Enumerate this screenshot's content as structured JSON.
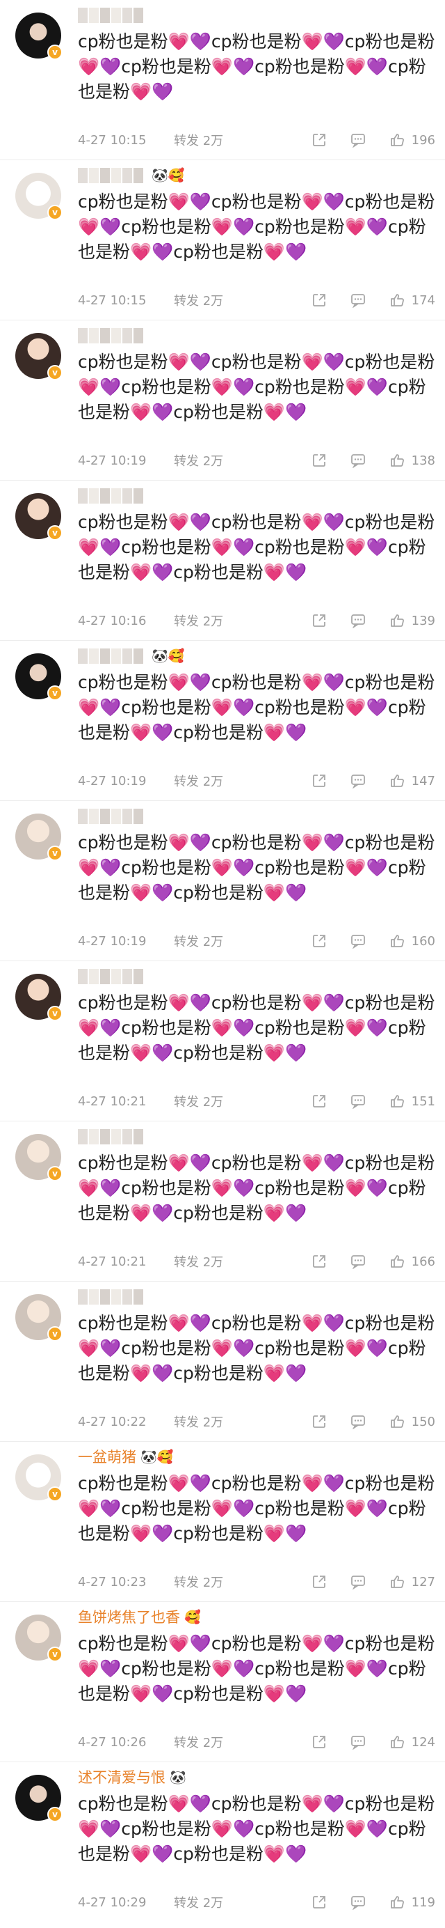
{
  "comments": [
    {
      "name": "",
      "emblems": "",
      "text": "cp粉也是粉💗💜cp粉也是粉💗💜cp粉也是粉💗💜cp粉也是粉💗💜cp粉也是粉💗💜cp粉也是粉💗💜",
      "time": "4-27 10:15",
      "repost": "转发 2万",
      "likes": "196",
      "avatar": "dark"
    },
    {
      "name": "",
      "emblems": "🐼🥰",
      "text": "cp粉也是粉💗💜cp粉也是粉💗💜cp粉也是粉💗💜cp粉也是粉💗💜cp粉也是粉💗💜cp粉也是粉💗💜cp粉也是粉💗💜",
      "time": "4-27 10:15",
      "repost": "转发 2万",
      "likes": "174",
      "avatar": "cartoon"
    },
    {
      "name": "",
      "emblems": "",
      "text": "cp粉也是粉💗💜cp粉也是粉💗💜cp粉也是粉💗💜cp粉也是粉💗💜cp粉也是粉💗💜cp粉也是粉💗💜cp粉也是粉💗💜",
      "time": "4-27 10:19",
      "repost": "转发 2万",
      "likes": "138",
      "avatar": "normal"
    },
    {
      "name": "",
      "emblems": "",
      "text": "cp粉也是粉💗💜cp粉也是粉💗💜cp粉也是粉💗💜cp粉也是粉💗💜cp粉也是粉💗💜cp粉也是粉💗💜cp粉也是粉💗💜",
      "time": "4-27 10:16",
      "repost": "转发 2万",
      "likes": "139",
      "avatar": "normal"
    },
    {
      "name": "",
      "emblems": "🐼🥰",
      "text": "cp粉也是粉💗💜cp粉也是粉💗💜cp粉也是粉💗💜cp粉也是粉💗💜cp粉也是粉💗💜cp粉也是粉💗💜cp粉也是粉💗💜",
      "time": "4-27 10:19",
      "repost": "转发 2万",
      "likes": "147",
      "avatar": "dark"
    },
    {
      "name": "",
      "emblems": "",
      "text": "cp粉也是粉💗💜cp粉也是粉💗💜cp粉也是粉💗💜cp粉也是粉💗💜cp粉也是粉💗💜cp粉也是粉💗💜cp粉也是粉💗💜",
      "time": "4-27 10:19",
      "repost": "转发 2万",
      "likes": "160",
      "avatar": "light"
    },
    {
      "name": "",
      "emblems": "",
      "text": "cp粉也是粉💗💜cp粉也是粉💗💜cp粉也是粉💗💜cp粉也是粉💗💜cp粉也是粉💗💜cp粉也是粉💗💜cp粉也是粉💗💜",
      "time": "4-27 10:21",
      "repost": "转发 2万",
      "likes": "151",
      "avatar": "normal"
    },
    {
      "name": "",
      "emblems": "",
      "text": "cp粉也是粉💗💜cp粉也是粉💗💜cp粉也是粉💗💜cp粉也是粉💗💜cp粉也是粉💗💜cp粉也是粉💗💜cp粉也是粉💗💜",
      "time": "4-27 10:21",
      "repost": "转发 2万",
      "likes": "166",
      "avatar": "light"
    },
    {
      "name": "",
      "emblems": "",
      "text": "cp粉也是粉💗💜cp粉也是粉💗💜cp粉也是粉💗💜cp粉也是粉💗💜cp粉也是粉💗💜cp粉也是粉💗💜cp粉也是粉💗💜",
      "time": "4-27 10:22",
      "repost": "转发 2万",
      "likes": "150",
      "avatar": "light"
    },
    {
      "name": "一盆萌猪",
      "emblems": "🐼🥰",
      "text": "cp粉也是粉💗💜cp粉也是粉💗💜cp粉也是粉💗💜cp粉也是粉💗💜cp粉也是粉💗💜cp粉也是粉💗💜cp粉也是粉💗💜",
      "time": "4-27 10:23",
      "repost": "转发 2万",
      "likes": "127",
      "avatar": "cartoon"
    },
    {
      "name": "鱼饼烤焦了也香",
      "emblems": "🥰",
      "text": "cp粉也是粉💗💜cp粉也是粉💗💜cp粉也是粉💗💜cp粉也是粉💗💜cp粉也是粉💗💜cp粉也是粉💗💜cp粉也是粉💗💜",
      "time": "4-27 10:26",
      "repost": "转发 2万",
      "likes": "124",
      "avatar": "light"
    },
    {
      "name": "述不清爱与恨",
      "emblems": "🐼",
      "text": "cp粉也是粉💗💜cp粉也是粉💗💜cp粉也是粉💗💜cp粉也是粉💗💜cp粉也是粉💗💜cp粉也是粉💗💜cp粉也是粉💗💜",
      "time": "4-27 10:29",
      "repost": "转发 2万",
      "likes": "119",
      "avatar": "dark"
    }
  ],
  "icons": {
    "share": "share-icon",
    "comment": "comment-icon",
    "like": "thumbs-up-icon",
    "verified": "verified-badge-icon"
  },
  "colors": {
    "username": "#e8822a",
    "meta": "#9a9a9a",
    "badge": "#f5a623",
    "divider": "#ededed"
  }
}
